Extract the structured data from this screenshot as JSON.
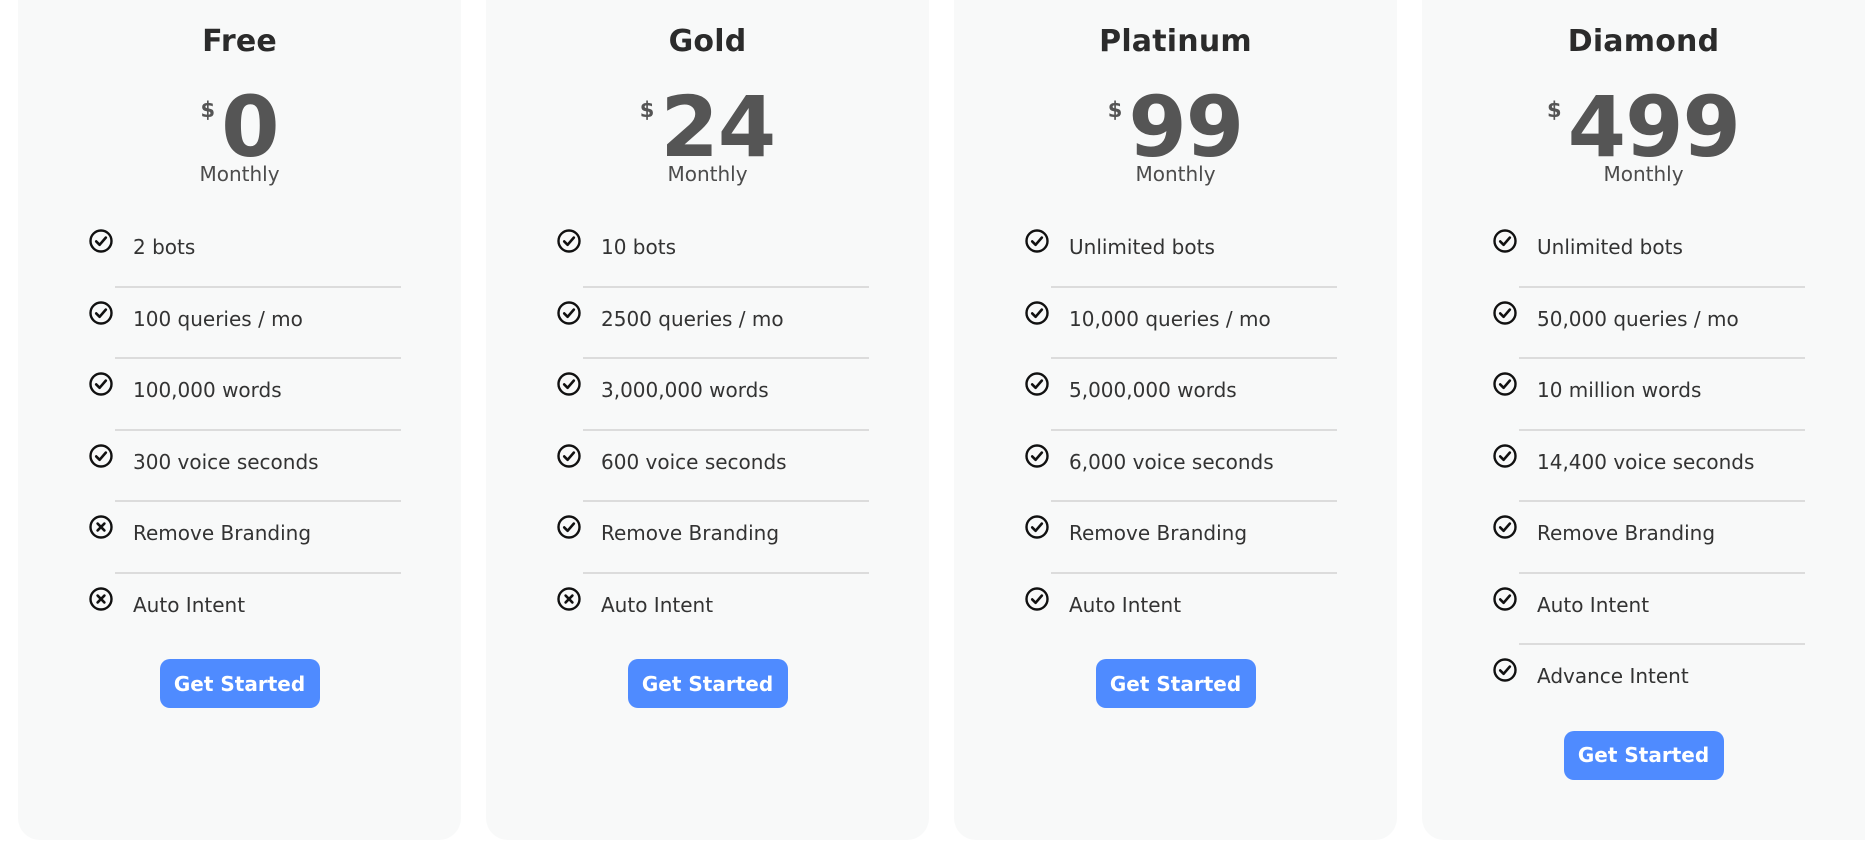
{
  "colors": {
    "card_bg": "#f8f9f9",
    "button_bg": "#4f8bff",
    "button_text": "#ffffff",
    "price_text": "#555555",
    "title_text": "#2b2b2b",
    "divider": "#dcdcdc"
  },
  "plans": [
    {
      "name": "Free",
      "currency": "$",
      "price": "0",
      "period": "Monthly",
      "features": [
        {
          "label": "2 bots",
          "included": true,
          "icon": "check-circle-icon"
        },
        {
          "label": "100 queries / mo",
          "included": true,
          "icon": "check-circle-icon"
        },
        {
          "label": "100,000 words",
          "included": true,
          "icon": "check-circle-icon"
        },
        {
          "label": "300 voice seconds",
          "included": true,
          "icon": "check-circle-icon"
        },
        {
          "label": "Remove Branding",
          "included": false,
          "icon": "x-circle-icon"
        },
        {
          "label": "Auto Intent",
          "included": false,
          "icon": "x-circle-icon"
        }
      ],
      "cta_label": "Get Started"
    },
    {
      "name": "Gold",
      "currency": "$",
      "price": "24",
      "period": "Monthly",
      "features": [
        {
          "label": "10 bots",
          "included": true,
          "icon": "check-circle-icon"
        },
        {
          "label": "2500 queries / mo",
          "included": true,
          "icon": "check-circle-icon"
        },
        {
          "label": "3,000,000 words",
          "included": true,
          "icon": "check-circle-icon"
        },
        {
          "label": "600 voice seconds",
          "included": true,
          "icon": "check-circle-icon"
        },
        {
          "label": "Remove Branding",
          "included": true,
          "icon": "check-circle-icon"
        },
        {
          "label": "Auto Intent",
          "included": false,
          "icon": "x-circle-icon"
        }
      ],
      "cta_label": "Get Started"
    },
    {
      "name": "Platinum",
      "currency": "$",
      "price": "99",
      "period": "Monthly",
      "features": [
        {
          "label": "Unlimited bots",
          "included": true,
          "icon": "check-circle-icon"
        },
        {
          "label": "10,000 queries / mo",
          "included": true,
          "icon": "check-circle-icon"
        },
        {
          "label": "5,000,000 words",
          "included": true,
          "icon": "check-circle-icon"
        },
        {
          "label": "6,000 voice seconds",
          "included": true,
          "icon": "check-circle-icon"
        },
        {
          "label": "Remove Branding",
          "included": true,
          "icon": "check-circle-icon"
        },
        {
          "label": "Auto Intent",
          "included": true,
          "icon": "check-circle-icon"
        }
      ],
      "cta_label": "Get Started"
    },
    {
      "name": "Diamond",
      "currency": "$",
      "price": "499",
      "period": "Monthly",
      "features": [
        {
          "label": "Unlimited bots",
          "included": true,
          "icon": "check-circle-icon"
        },
        {
          "label": "50,000 queries / mo",
          "included": true,
          "icon": "check-circle-icon"
        },
        {
          "label": "10 million words",
          "included": true,
          "icon": "check-circle-icon"
        },
        {
          "label": "14,400 voice seconds",
          "included": true,
          "icon": "check-circle-icon"
        },
        {
          "label": "Remove Branding",
          "included": true,
          "icon": "check-circle-icon"
        },
        {
          "label": "Auto Intent",
          "included": true,
          "icon": "check-circle-icon"
        },
        {
          "label": "Advance Intent",
          "included": true,
          "icon": "check-circle-icon"
        }
      ],
      "cta_label": "Get Started"
    }
  ]
}
